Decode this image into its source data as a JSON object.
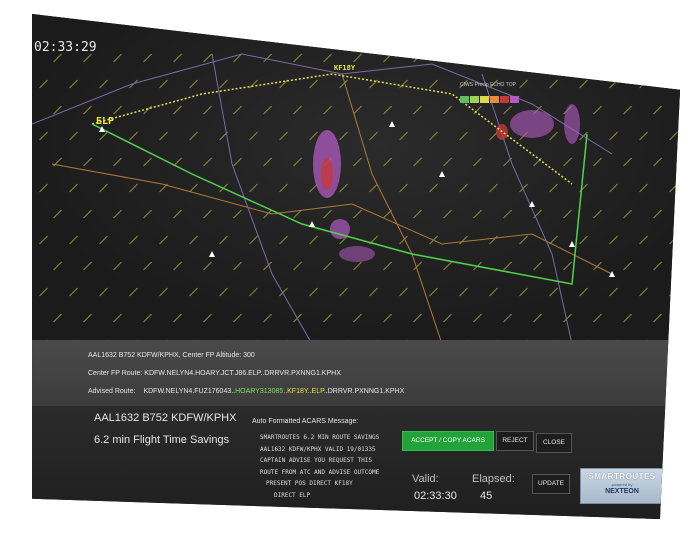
{
  "map": {
    "clock": "02:33:29",
    "elp_label": "ELP",
    "kf18y_label": "KF18Y",
    "legend_title": "CIWS Precip  ECHO TOP",
    "legend_colors": [
      "#5fbf5f",
      "#9fd34f",
      "#e0d84a",
      "#e88a3a",
      "#c43a3a",
      "#b25bc2"
    ]
  },
  "info": {
    "line1": "AAL1632 B752 KDFW/KPHX, Center FP Altitude: 300",
    "line2": "Center FP Route: KDFW.NELYN4.HOARY.JCT.J86.ELP..DRRVR.PXNNG1.KPHX",
    "advised_label": "Advised Route:",
    "advised_prefix": "KDFW.NELYN4.FUZ176043..",
    "advised_green": "HOARY313085",
    "advised_yellow": "..KF18Y..ELP",
    "advised_suffix": "..DRRVR.PXNNG1.KPHX"
  },
  "panel": {
    "flight": "AAL1632 B752 KDFW/KPHX",
    "savings": "6.2 min Flight Time Savings",
    "acars_title": "Auto Formatted ACARS Message:",
    "acars_lines": [
      "SMARTROUTES 6.2 MIN ROUTE SAVINGS",
      "AAL1632 KDFW/KPHX VALID 19/01335",
      "CAPTAIN ADVISE YOU REQUEST THIS",
      "ROUTE FROM ATC AND ADVISE OUTCOME",
      "PRESENT POS DIRECT KF18Y",
      "DIRECT ELP"
    ],
    "accept_label": "ACCEPT / COPY ACARS",
    "reject_label": "REJECT",
    "close_label": "CLOSE",
    "update_label": "UPDATE",
    "valid_label": "Valid:",
    "valid_value": "02:33:30",
    "elapsed_label": "Elapsed:",
    "elapsed_value": "45",
    "brand_name": "SMARTROUTES",
    "brand_powered": "powered by",
    "brand_company": "NEXTEON"
  }
}
